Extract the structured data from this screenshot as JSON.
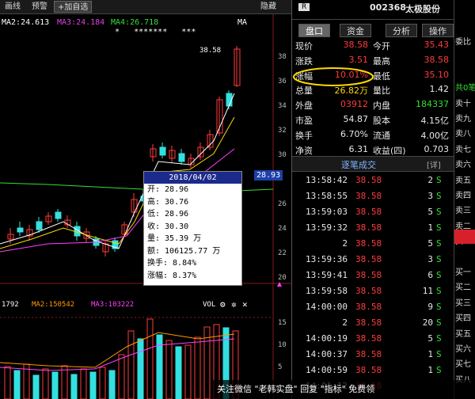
{
  "toolbar": {
    "btn1": "画线",
    "btn2": "预警",
    "btn3": "+加自选",
    "right": "隐藏"
  },
  "ma": {
    "ma2": "MA2:24.613",
    "ma3": "MA3:24.184",
    "ma4": "MA4:26.718",
    "ma": "MA"
  },
  "stars": "*   *******   ***",
  "price_axis": [
    "38",
    "36",
    "34",
    "32",
    "30",
    "28",
    "26",
    "24",
    "22",
    "20"
  ],
  "current_price_tag": "28.93",
  "high_label": "38.58",
  "vol_legend": {
    "v1": "1792",
    "ma2": "MA2:150542",
    "ma3": "MA3:103222",
    "vol": "VOL"
  },
  "vol_axis": [
    "15",
    "10",
    "5"
  ],
  "tooltip": {
    "date": "2018/04/02",
    "rows": [
      "开: 28.96",
      "高: 30.76",
      "低: 28.96",
      "收: 30.30",
      "量: 35.39 万",
      "额: 106125.77 万",
      "换手: 8.84%",
      "涨幅: 8.37%"
    ]
  },
  "stock": {
    "code": "002368",
    "name": "太极股份",
    "r": "R"
  },
  "tabs": [
    "盘口",
    "资金",
    "分析",
    "操作"
  ],
  "quote": {
    "r1": {
      "k1": "现价",
      "v1": "38.58",
      "k2": "今开",
      "v2": "35.43"
    },
    "r2": {
      "k1": "涨跌",
      "v1": "3.51",
      "k2": "最高",
      "v2": "38.58"
    },
    "r3": {
      "k1": "涨幅",
      "v1": "10.01%",
      "k2": "最低",
      "v2": "35.10"
    },
    "r4": {
      "k1": "总量",
      "v1": "26.82万",
      "k2": "量比",
      "v2": "1.42"
    },
    "r5": {
      "k1": "外盘",
      "v1": "03912",
      "k2": "内盘",
      "v2": "184337"
    },
    "r6": {
      "k1": "市盈",
      "v1": "54.87",
      "k2": "股本",
      "v2": "4.15亿"
    },
    "r7": {
      "k1": "换手",
      "v1": "6.70%",
      "k2": "流通",
      "v2": "4.00亿"
    },
    "r8": {
      "k1": "净资",
      "v1": "6.31",
      "k2": "收益(四)",
      "v2": "0.703"
    }
  },
  "ticks_header": {
    "title": "逐笔成交",
    "detail": "[详]"
  },
  "ticks": [
    {
      "t": "13:58:42",
      "p": "38.58",
      "v": "2",
      "s": "S"
    },
    {
      "t": "13:58:55",
      "p": "38.58",
      "v": "3",
      "s": "S"
    },
    {
      "t": "13:59:03",
      "p": "38.58",
      "v": "5",
      "s": "S"
    },
    {
      "t": "13:59:32",
      "p": "38.58",
      "v": "1",
      "s": "S"
    },
    {
      "t": "2",
      "p": "38.58",
      "v": "5",
      "s": "S"
    },
    {
      "t": "13:59:36",
      "p": "38.58",
      "v": "3",
      "s": "S"
    },
    {
      "t": "13:59:41",
      "p": "38.58",
      "v": "6",
      "s": "S"
    },
    {
      "t": "13:59:58",
      "p": "38.58",
      "v": "11",
      "s": "S"
    },
    {
      "t": "14:00:00",
      "p": "38.58",
      "v": "9",
      "s": "S"
    },
    {
      "t": "2",
      "p": "38.58",
      "v": "20",
      "s": "S"
    },
    {
      "t": "14:00:19",
      "p": "38.58",
      "v": "5",
      "s": "S"
    },
    {
      "t": "14:00:37",
      "p": "38.58",
      "v": "1",
      "s": "S"
    },
    {
      "t": "14:00:59",
      "p": "38.58",
      "v": "1",
      "s": "S"
    },
    {
      "t": "14:01:12",
      "p": "38.58",
      "v": "",
      "s": ""
    }
  ],
  "far_right": [
    "委比",
    "",
    "",
    "共0笔",
    "卖十",
    "卖九",
    "卖八",
    "卖七",
    "卖六",
    "卖五",
    "卖四",
    "卖三",
    "卖二",
    "卖一",
    "",
    "买一",
    "买二",
    "买三",
    "买四",
    "买五",
    "买六",
    "买七",
    "买八"
  ],
  "watermark": "关注微信 \"老韩实盘\" 回复 \"指标\" 免费领"
}
